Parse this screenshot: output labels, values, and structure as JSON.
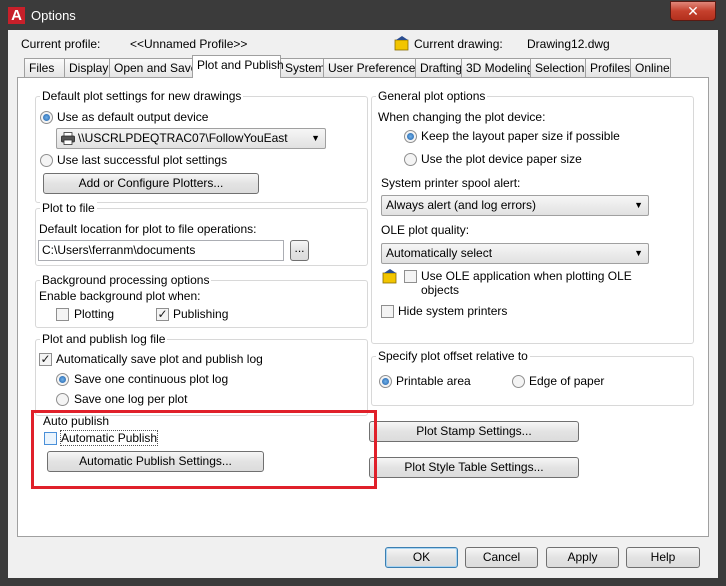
{
  "window": {
    "title": "Options"
  },
  "profile": {
    "current_profile_label": "Current profile:",
    "current_profile_value": "<<Unnamed Profile>>",
    "current_drawing_label": "Current drawing:",
    "current_drawing_value": "Drawing12.dwg"
  },
  "tabs": [
    {
      "label": "Files"
    },
    {
      "label": "Display"
    },
    {
      "label": "Open and Save"
    },
    {
      "label": "Plot and Publish"
    },
    {
      "label": "System"
    },
    {
      "label": "User Preferences"
    },
    {
      "label": "Drafting"
    },
    {
      "label": "3D Modeling"
    },
    {
      "label": "Selection"
    },
    {
      "label": "Profiles"
    },
    {
      "label": "Online"
    }
  ],
  "default_plot": {
    "title": "Default plot settings for new drawings",
    "use_default_device": "Use as default output device",
    "device_value": "\\\\USCRLPDEQTRAC07\\FollowYouEast",
    "use_last_successful": "Use last successful plot settings",
    "add_configure_button": "Add or Configure Plotters..."
  },
  "plot_to_file": {
    "title": "Plot to file",
    "location_label": "Default location for plot to file operations:",
    "location_value": "C:\\Users\\ferranm\\documents",
    "browse_button": "..."
  },
  "background": {
    "title": "Background processing options",
    "enable_label": "Enable background plot when:",
    "plotting": "Plotting",
    "publishing": "Publishing"
  },
  "log": {
    "title": "Plot and publish log file",
    "auto_save": "Automatically save plot and publish log",
    "one_continuous": "Save one continuous plot log",
    "one_per_plot": "Save one log per plot"
  },
  "auto_publish": {
    "title": "Auto publish",
    "automatic_publish": "Automatic Publish",
    "settings_button": "Automatic Publish Settings..."
  },
  "general": {
    "title": "General plot options",
    "changing_label": "When changing the plot device:",
    "keep_layout": "Keep the layout paper size if possible",
    "use_device_paper": "Use the plot device paper size",
    "spool_label": "System printer spool alert:",
    "spool_value": "Always alert (and log errors)",
    "ole_quality_label": "OLE plot quality:",
    "ole_quality_value": "Automatically select",
    "use_ole_app_line1": "Use OLE application when plotting OLE",
    "use_ole_app_line2": "objects",
    "hide_printers": "Hide system printers"
  },
  "offset": {
    "title": "Specify plot offset relative to",
    "printable_area": "Printable area",
    "edge_of_paper": "Edge of paper"
  },
  "buttons": {
    "plot_stamp": "Plot Stamp Settings...",
    "plot_style_table": "Plot Style Table Settings...",
    "ok": "OK",
    "cancel": "Cancel",
    "apply": "Apply",
    "help": "Help"
  },
  "icons": {
    "app": "autocad-app-icon",
    "printer": "printer-icon",
    "drawing": "drawing-file-icon",
    "ole_warning": "ole-warning-icon"
  },
  "colors": {
    "highlight_border": "#e0202a",
    "radio_selected": "#1e5ea8"
  }
}
